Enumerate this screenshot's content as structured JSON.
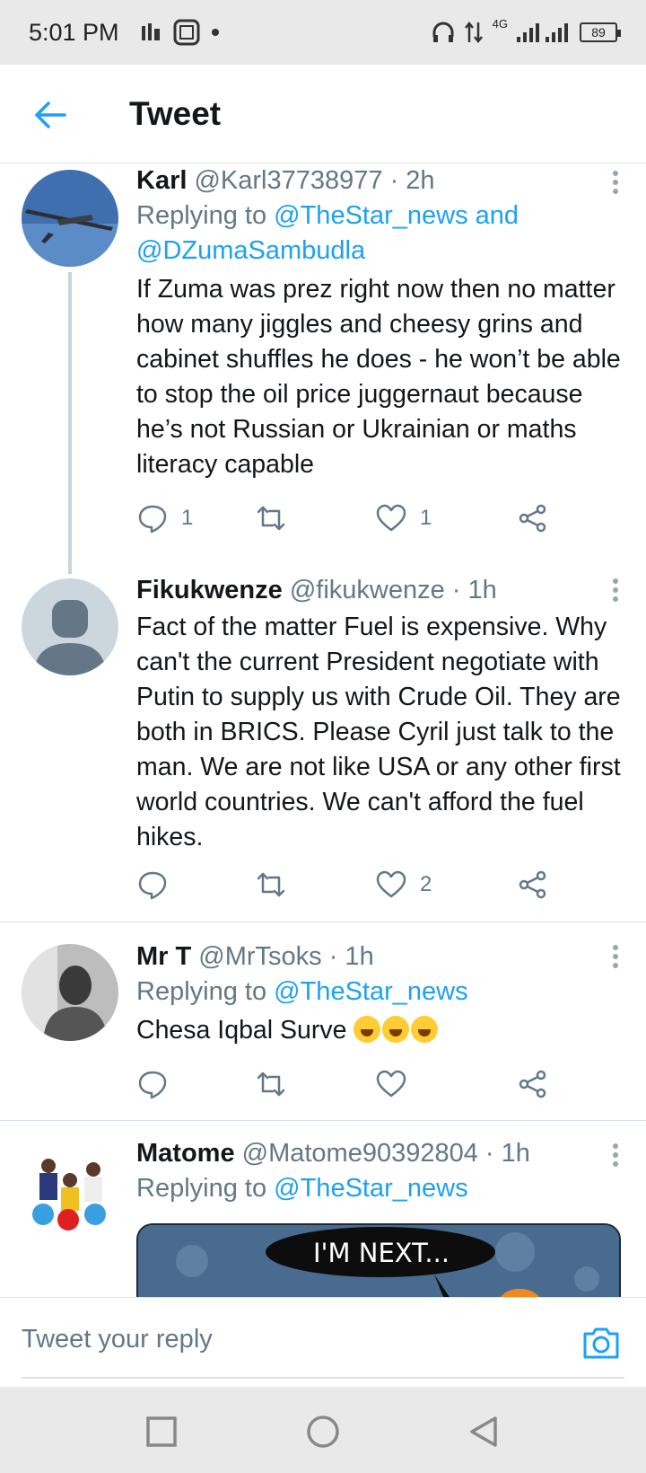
{
  "status": {
    "time": "5:01 PM",
    "network": "4G",
    "battery": "89"
  },
  "header": {
    "title": "Tweet"
  },
  "tweets": [
    {
      "name": "Karl",
      "handle": "@Karl37738977 · 2h",
      "reply_prefix": "Replying to",
      "reply_to": "@TheStar_news and @DZumaSambudla",
      "text": "If Zuma was prez right now then no matter how many jiggles and cheesy grins and cabinet shuffles he does - he won’t be able to stop the oil price juggernaut because he’s not Russian or Ukrainian or maths literacy capable",
      "replies": "1",
      "retweets": "",
      "likes": "1"
    },
    {
      "name": "Fikukwenze",
      "handle": "@fikukwenze · 1h",
      "text": "Fact of the matter Fuel is expensive. Why can't the current President negotiate with Putin to supply us with Crude Oil. They are both in BRICS. Please Cyril just talk to the man. We are not like USA or any other first world countries. We can't afford the fuel hikes.",
      "replies": "",
      "retweets": "",
      "likes": "2"
    },
    {
      "name": "Mr T",
      "handle": "@MrTsoks · 1h",
      "reply_prefix": "Replying to",
      "reply_to": "@TheStar_news",
      "text": "Chesa Iqbal Surve",
      "replies": "",
      "retweets": "",
      "likes": ""
    },
    {
      "name": "Matome",
      "handle": "@Matome90392804 · 1h",
      "reply_prefix": "Replying to",
      "reply_to": "@TheStar_news",
      "media_caption": "I'M NEXT..."
    }
  ],
  "reply_bar": {
    "placeholder": "Tweet your reply"
  },
  "colors": {
    "accent": "#1da1f2",
    "secondary_text": "#657786",
    "border": "#dbe2e7"
  }
}
